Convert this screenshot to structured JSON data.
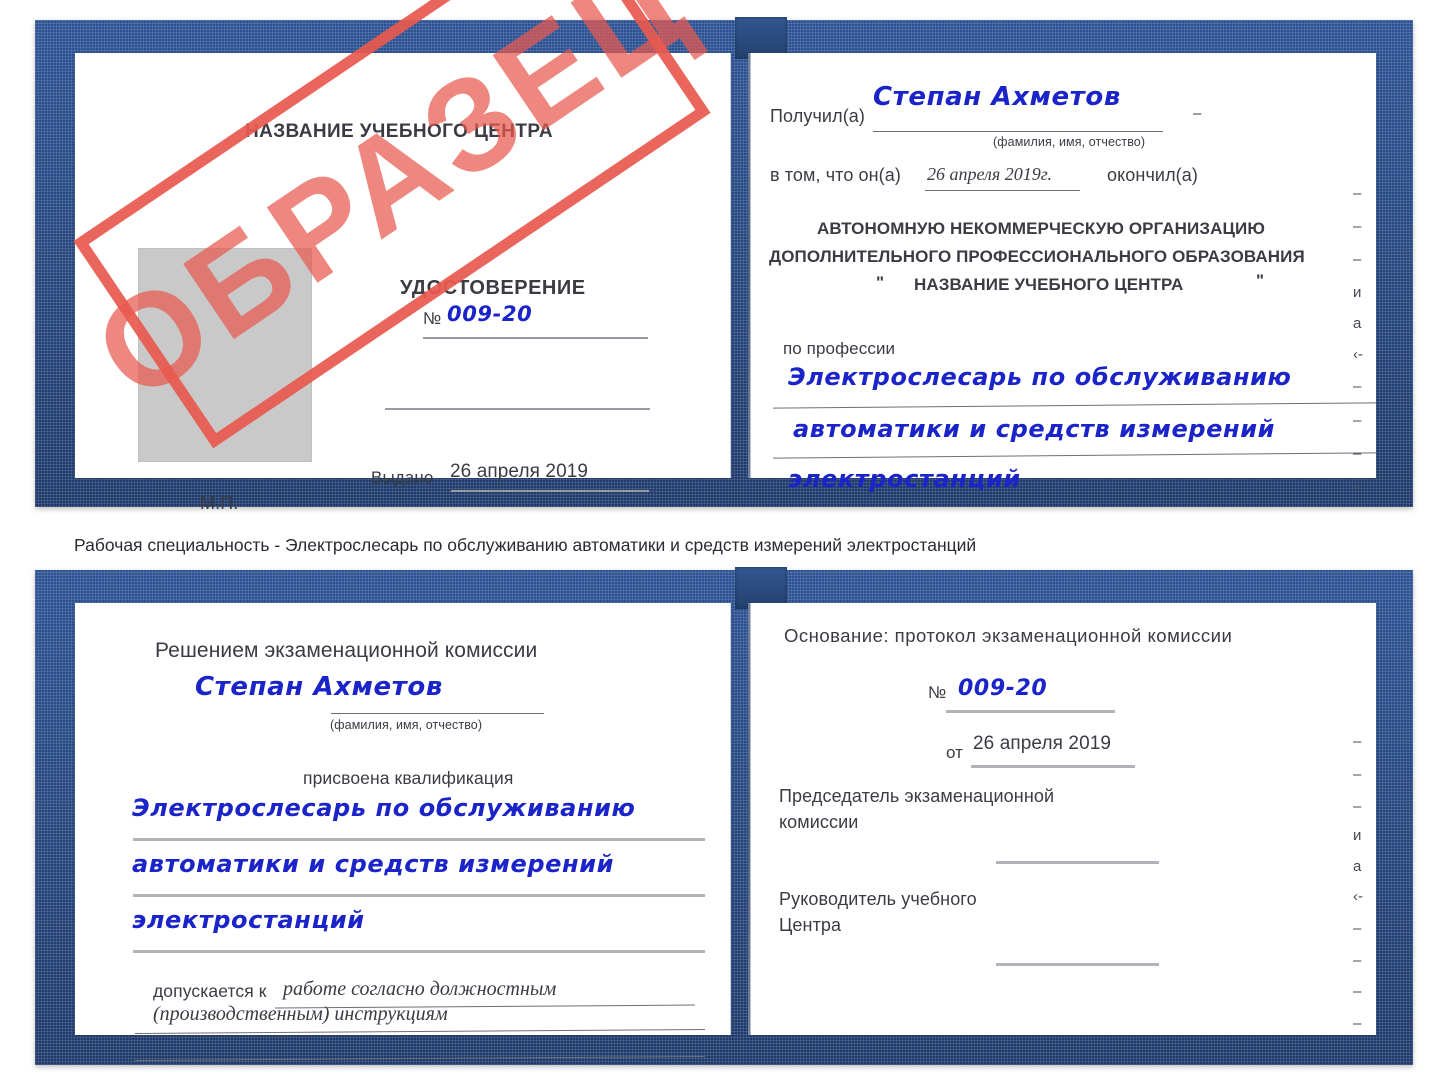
{
  "document": {
    "kind": "Удостоверение",
    "watermark": "ОБРАЗЕЦ",
    "accent_blue_cover": "#27477f",
    "accent_stamp_red": "#e8594f",
    "handwriting_ink": "#1a24c8"
  },
  "caption": {
    "text": "Рабочая специальность - Электрослесарь по обслуживанию автоматики и средств измерений электростанций"
  },
  "certificate_top": {
    "left_page": {
      "center_name": "НАЗВАНИЕ УЧЕБНОГО ЦЕНТРА",
      "title": "УДОСТОВЕРЕНИЕ",
      "number_label": "№",
      "number_value": "009-20",
      "issued_label": "Выдано",
      "issued_value": "26 апреля 2019",
      "seal_label": "М.П.",
      "photo_placeholder": "photo-area"
    },
    "right_page": {
      "received_label": "Получил(а)",
      "received_value": "Степан Ахметов",
      "received_hint": "(фамилия, имя, отчество)",
      "that_he_label": "в том, что он(а)",
      "that_he_value": "26 апреля 2019г.",
      "graduated_label": "окончил(а)",
      "org_line1": "АВТОНОМНУЮ НЕКОММЕРЧЕСКУЮ ОРГАНИЗАЦИЮ",
      "org_line2": "ДОПОЛНИТЕЛЬНОГО ПРОФЕССИОНАЛЬНОГО ОБРАЗОВАНИЯ",
      "org_quote_open": "\"",
      "org_line3": "НАЗВАНИЕ УЧЕБНОГО ЦЕНТРА",
      "org_quote_close": "\"",
      "profession_label": "по профессии",
      "profession_line1": "Электрослесарь по обслуживанию",
      "profession_line2": "автоматики и средств измерений",
      "profession_line3": "электростанций",
      "edge_fragments": [
        "–",
        "–",
        "–",
        "и",
        "а",
        "‹-",
        "–",
        "–",
        "–",
        "–"
      ]
    }
  },
  "certificate_bottom": {
    "left_page": {
      "heading": "Решением экзаменационной комиссии",
      "name_value": "Степан Ахметов",
      "name_hint": "(фамилия, имя, отчество)",
      "qualification_label": "присвоена квалификация",
      "qualification_line1": "Электрослесарь по обслуживанию",
      "qualification_line2": "автоматики и средств измерений",
      "qualification_line3": "электростанций",
      "allowed_label": "допускается к",
      "allowed_value_line1": "работе согласно должностным",
      "allowed_value_line2": "(производственным) инструкциям"
    },
    "right_page": {
      "basis_label": "Основание: протокол экзаменационной комиссии",
      "protocol_number_label": "№",
      "protocol_number_value": "009-20",
      "protocol_date_label": "от",
      "protocol_date_value": "26 апреля 2019",
      "chairman_line1": "Председатель экзаменационной",
      "chairman_line2": "комиссии",
      "head_line1": "Руководитель учебного",
      "head_line2": "Центра",
      "edge_fragments": [
        "–",
        "–",
        "–",
        "и",
        "а",
        "‹-",
        "–",
        "–",
        "–",
        "–"
      ]
    }
  }
}
